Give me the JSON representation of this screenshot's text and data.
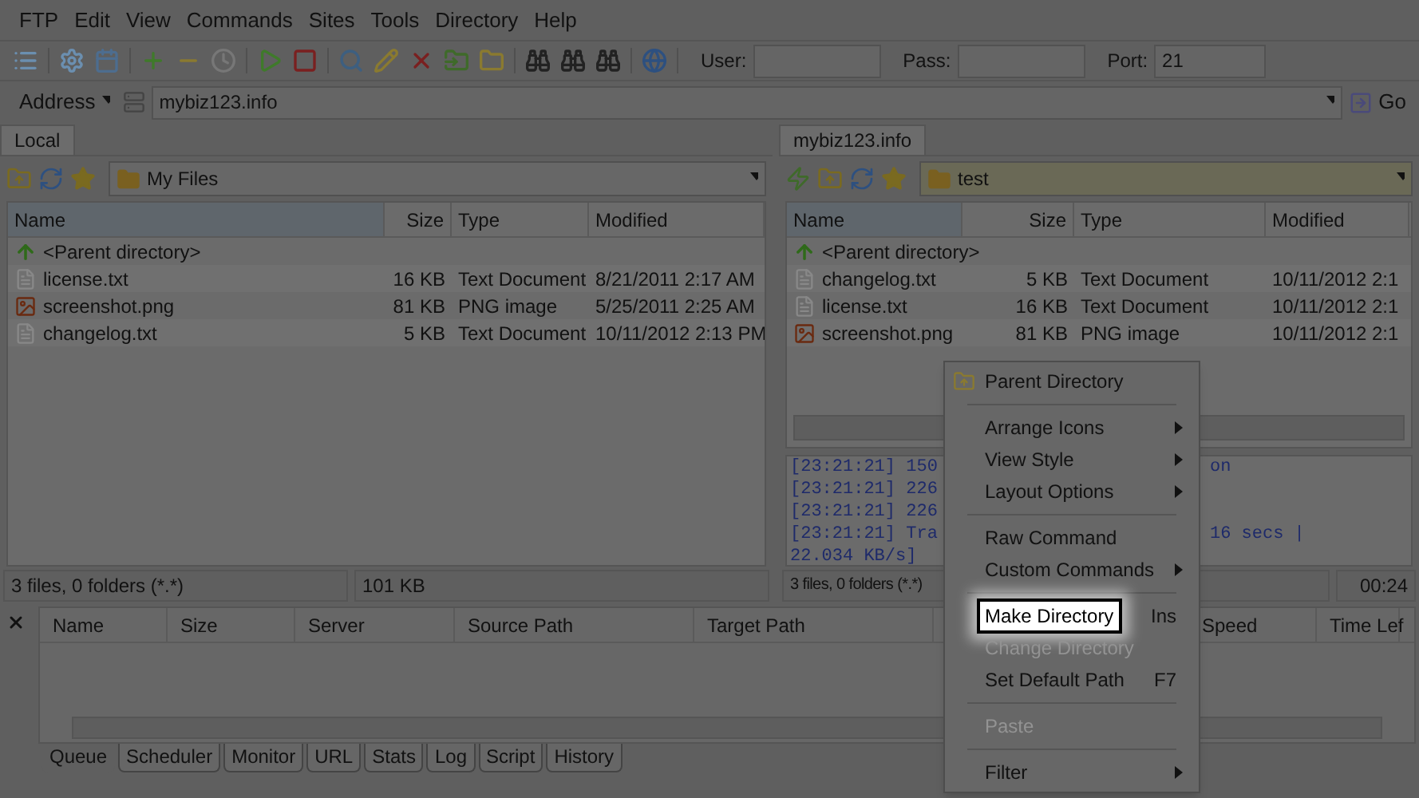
{
  "menu_bar": [
    "FTP",
    "Edit",
    "View",
    "Commands",
    "Sites",
    "Tools",
    "Directory",
    "Help"
  ],
  "toolbar": {
    "fields": [
      {
        "label": "User:"
      },
      {
        "label": "Pass:"
      },
      {
        "label": "Port:",
        "value": "21"
      }
    ]
  },
  "address_bar": {
    "label": "Address",
    "value": "mybiz123.info",
    "go": "Go"
  },
  "local_pane": {
    "tab": "Local",
    "path": "My Files",
    "columns": [
      "Name",
      "Size",
      "Type",
      "Modified"
    ],
    "rows": [
      {
        "kind": "parent",
        "name": "<Parent directory>"
      },
      {
        "kind": "text",
        "name": "license.txt",
        "size": "16 KB",
        "type": "Text Document",
        "modified": "8/21/2011 2:17 AM"
      },
      {
        "kind": "image",
        "name": "screenshot.png",
        "size": "81 KB",
        "type": "PNG image",
        "modified": "5/25/2011 2:25 AM"
      },
      {
        "kind": "text",
        "name": "changelog.txt",
        "size": "5 KB",
        "type": "Text Document",
        "modified": "10/11/2012 2:13 PM"
      }
    ],
    "status": [
      "3 files, 0 folders (*.*)",
      "101 KB"
    ]
  },
  "remote_pane": {
    "tab": "mybiz123.info",
    "path": "test",
    "columns": [
      "Name",
      "Size",
      "Type",
      "Modified"
    ],
    "rows": [
      {
        "kind": "parent",
        "name": "<Parent directory>"
      },
      {
        "kind": "text",
        "name": "changelog.txt",
        "size": "5 KB",
        "type": "Text Document",
        "modified": "10/11/2012 2:1"
      },
      {
        "kind": "text",
        "name": "license.txt",
        "size": "16 KB",
        "type": "Text Document",
        "modified": "10/11/2012 2:1"
      },
      {
        "kind": "image",
        "name": "screenshot.png",
        "size": "81 KB",
        "type": "PNG image",
        "modified": "10/11/2012 2:1"
      }
    ],
    "log": [
      {
        "text": "[23:21:21] 150",
        "tail": "on"
      },
      {
        "text": "[23:21:21] 226"
      },
      {
        "text": "[23:21:21] 226"
      },
      {
        "text": "[23:21:21] Tra",
        "tail": "16 secs |"
      },
      {
        "text": "22.034 KB/s]"
      }
    ],
    "status": [
      "3 files, 0 folders (*.*)",
      "00:24"
    ]
  },
  "queue": {
    "columns": [
      "Name",
      "Size",
      "Server",
      "Source Path",
      "Target Path",
      "Speed",
      "Time Lef"
    ],
    "tabs": [
      {
        "label": "Queue",
        "selected": true
      },
      {
        "label": "Scheduler",
        "selected": false
      },
      {
        "label": "Monitor",
        "selected": false
      },
      {
        "label": "URL",
        "selected": false
      },
      {
        "label": "Stats",
        "selected": false
      },
      {
        "label": "Log",
        "selected": false
      },
      {
        "label": "Script",
        "selected": false
      },
      {
        "label": "History",
        "selected": false
      }
    ]
  },
  "context_menu": [
    {
      "kind": "item",
      "label": "Parent Directory",
      "icon": true,
      "selected": false,
      "disabled": false,
      "submenu": false
    },
    {
      "kind": "separator"
    },
    {
      "kind": "item",
      "label": "Arrange Icons",
      "selected": false,
      "disabled": false,
      "submenu": true
    },
    {
      "kind": "item",
      "label": "View Style",
      "selected": false,
      "disabled": false,
      "submenu": true
    },
    {
      "kind": "item",
      "label": "Layout Options",
      "selected": false,
      "disabled": false,
      "submenu": true
    },
    {
      "kind": "separator"
    },
    {
      "kind": "item",
      "label": "Raw Command",
      "selected": false,
      "disabled": false,
      "submenu": false
    },
    {
      "kind": "item",
      "label": "Custom Commands",
      "selected": false,
      "disabled": false,
      "submenu": true
    },
    {
      "kind": "separator"
    },
    {
      "kind": "item",
      "label": "Make Directory",
      "shortcut": "Ins",
      "selected": true,
      "disabled": false,
      "submenu": false
    },
    {
      "kind": "item",
      "label": "Change Directory",
      "selected": false,
      "disabled": true,
      "submenu": false
    },
    {
      "kind": "item",
      "label": "Set Default Path",
      "shortcut": "F7",
      "selected": false,
      "disabled": false,
      "submenu": false
    },
    {
      "kind": "separator"
    },
    {
      "kind": "item",
      "label": "Paste",
      "selected": false,
      "disabled": true,
      "submenu": false
    },
    {
      "kind": "separator"
    },
    {
      "kind": "item",
      "label": "Filter",
      "selected": false,
      "disabled": false,
      "submenu": true
    }
  ]
}
